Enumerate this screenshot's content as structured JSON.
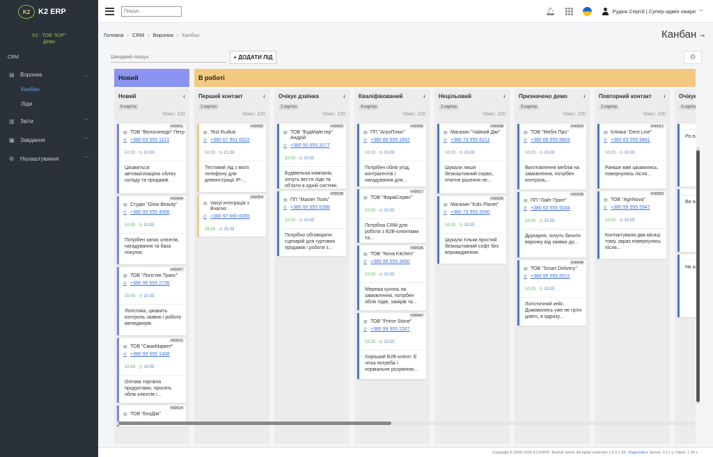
{
  "app": {
    "logo_text": "K2 ERP",
    "logo_mark": "K2",
    "org_line1": "K2 : ТОВ \"K2P\"",
    "org_line2": "Демо"
  },
  "sidebar": {
    "section": "CRM",
    "items": [
      {
        "label": "Воронка",
        "icon": "funnel-icon"
      },
      {
        "label": "Звіти",
        "icon": "chart-icon"
      },
      {
        "label": "Завдання",
        "icon": "calendar-icon"
      },
      {
        "label": "Налаштування",
        "icon": "gear-icon"
      }
    ],
    "sub_items": [
      {
        "label": "Канбан",
        "active": true
      },
      {
        "label": "Ліди",
        "active": false
      }
    ]
  },
  "topbar": {
    "search_placeholder": "Пошук...",
    "user": "Рудюк Сергій | Супер-адмін хмари"
  },
  "breadcrumb": [
    "Головна",
    "CRM",
    "Воронка",
    "Канбан"
  ],
  "page_title": "Канбан",
  "toolbar": {
    "quick_search_placeholder": "Швидкий пошук",
    "add_label": "+ ДОДАТИ ЛІД"
  },
  "groups": [
    {
      "label": "Новий",
      "color": "#8b94f0"
    },
    {
      "label": "В роботі",
      "color": "#f3c980"
    }
  ],
  "max_label": "Макс: 100",
  "columns": [
    {
      "title": "Новий",
      "count": "8 карток",
      "border": "#7b83ec",
      "cards": [
        {
          "num": "#00001",
          "name": "ТОВ \"Велосипеди\" Петр",
          "phone": "+380 63 555 1121",
          "d1": "10.03",
          "d2": "10.03",
          "desc": "Цікавиться автоматизацією обліку складу та продажів."
        },
        {
          "num": "#00004",
          "name": "Студія \"Glow Beauty\"",
          "phone": "+380 93 555 4566",
          "d1": "10.03",
          "d2": "10.03",
          "desc": "Потрібен запис клієнтів, нагадування та база покупок."
        },
        {
          "num": "#00007",
          "name": "ТОВ \"Логістик Транс\"",
          "phone": "+380 95 555 2735",
          "d1": "10.03",
          "d2": "10.03",
          "desc": "Логістика, цікавить контроль заявок і робота менеджерів."
        },
        {
          "num": "#00011",
          "name": "ТОВ \"СмакМаркет\"",
          "phone": "+380 99 555 1408",
          "d1": "10.03",
          "d2": "10.03",
          "desc": "Оптова торгівля продуктами, просять облік клієнтів і..."
        },
        {
          "num": "#00014",
          "name": "ТОВ \"ЕкоДім\"",
          "phone": "",
          "d1": "",
          "d2": "",
          "desc": ""
        }
      ]
    },
    {
      "title": "Перший контакт",
      "count": "2 картки",
      "border": "#f3c980",
      "cards": [
        {
          "num": "#00052",
          "name": "Test Rudiuk",
          "phone": "+380 67 901 6322",
          "d1": "10.03",
          "d2": "21.03",
          "desc": "Тестовий лід з мого телефону для демонстрації IP-..."
        },
        {
          "num": "#00054",
          "name": "Vasyl інтеграція з Вчасно",
          "phone": "+380 97 660 6065",
          "d1": "25.03",
          "d2": "25.03",
          "desc": ""
        }
      ]
    },
    {
      "title": "Очікує дзвінка",
      "count": "2 картки",
      "border": "#4a78c8",
      "cards": [
        {
          "num": "#00003",
          "name": "ТОВ \"БудМайстер\" Андрій",
          "phone": "+380 50 555 3177",
          "d1": "10.03",
          "d2": "10.03",
          "desc": "Будівельна компанія, хочуть вести ліди та об'єкти в одній системі."
        },
        {
          "num": "#00039",
          "name": "ПП \"Master Tools\"",
          "phone": "+380 50 555 5288",
          "d1": "10.03",
          "d2": "10.03",
          "desc": "Потрібно обговорити сценарій для гуртових продажів і роботи з..."
        }
      ]
    },
    {
      "title": "Кваліфікований",
      "count": "4 картки",
      "border": "#4a78c8",
      "cards": [
        {
          "num": "#00005",
          "name": "ПП \"АгроПлюс\"",
          "phone": "+380 66 555 1842",
          "d1": "10.03",
          "d2": "10.03",
          "desc": "Потрібен облік угод, контрагентів і нагадування для..."
        },
        {
          "num": "#00017",
          "name": "ТОВ \"ФармСервіс\"",
          "phone": "",
          "d1": "10.03",
          "d2": "10.03",
          "desc": "Потрібна CRM для роботи з B2B-клієнтами та..."
        },
        {
          "num": "#00036",
          "name": "ТОВ \"Nova Kitchen\"",
          "phone": "+380 99 555 3460",
          "d1": "10.03",
          "d2": "10.03",
          "desc": "Мережа кухонь на замовлення, потрібен облік лідів, замірів та..."
        },
        {
          "num": "#00047",
          "name": "ТОВ \"Prime Stone\"",
          "phone": "+380 99 555 2267",
          "d1": "10.03",
          "d2": "10.03",
          "desc": "Хороший B2B-клієнт. Є чітка потреба і нормальне розуміння..."
        }
      ]
    },
    {
      "title": "Нецільовий",
      "count": "2 картки",
      "border": "#4a78c8",
      "cards": [
        {
          "num": "#00008",
          "name": "Магазин \"Чайний Дім\"",
          "phone": "+380 73 555 6211",
          "d1": "10.03",
          "d2": "10.03",
          "desc": "Шукали лише безкоштовний сервіс, платне рішення не..."
        },
        {
          "num": "#00026",
          "name": "Магазин \"Kids Planet\"",
          "phone": "+380 73 555 3280",
          "d1": "10.03",
          "d2": "10.03",
          "desc": "Шукали тільки простий безкоштовний софт без впровадження."
        }
      ]
    },
    {
      "title": "Призначено демо",
      "count": "3 картки",
      "border": "#4a78c8",
      "cards": [
        {
          "num": "#00009",
          "name": "ТОВ \"Меблі Про\"",
          "phone": "+380 68 555 8803",
          "d1": "10.03",
          "d2": "10.03",
          "desc": "Виготовлення меблів на замовлення, потрібен контроль..."
        },
        {
          "num": "#00028",
          "name": "ПП \"Лайт Прінт\"",
          "phone": "+380 63 555 9244",
          "d1": "10.03",
          "d2": "10.03",
          "desc": "Друкарня, хочуть бачити воронку від заявки до..."
        },
        {
          "num": "#00049",
          "name": "ТОВ \"Smart Delivery\"",
          "phone": "+380 95 555 6512",
          "d1": "10.03",
          "d2": "10.03",
          "desc": "Логістичний кейс. Домовились уже не гріти довго, а одразу..."
        }
      ]
    },
    {
      "title": "Повторний контакт",
      "count": "2 картки",
      "border": "#4a78c8",
      "cards": [
        {
          "num": "#00012",
          "name": "Клініка \"Dent Line\"",
          "phone": "+380 63 555 9461",
          "d1": "10.03",
          "d2": "10.03",
          "desc": "Раніше вже цікавились, повернулись після..."
        },
        {
          "num": "#00033",
          "name": "ТОВ \"AgriNova\"",
          "phone": "+380 99 555 5947",
          "d1": "10.03",
          "d2": "10.03",
          "desc": "Контактували два місяці тому, зараз повернулись після..."
        }
      ]
    },
    {
      "title": "Очікує",
      "count": "3 картки",
      "border": "#4a78c8",
      "cards": [
        {
          "num": "",
          "name": "",
          "phone": "",
          "d1": "",
          "d2": "",
          "desc": "Ро ел ко"
        },
        {
          "num": "",
          "name": "",
          "phone": "",
          "d1": "",
          "d2": "",
          "desc": "Ви хо по"
        },
        {
          "num": "",
          "name": "",
          "phone": "",
          "d1": "",
          "d2": "",
          "desc": "Не ко пр"
        }
      ]
    }
  ],
  "footer": {
    "text": "Copyright © 2000-2026 K2 ERP®. Rudiuk Serhii. All rights reserved. v.2.5.1.95.",
    "link": "Diagnostics",
    "tail": "Server: 0.17 s, Client: 1.34 s"
  }
}
